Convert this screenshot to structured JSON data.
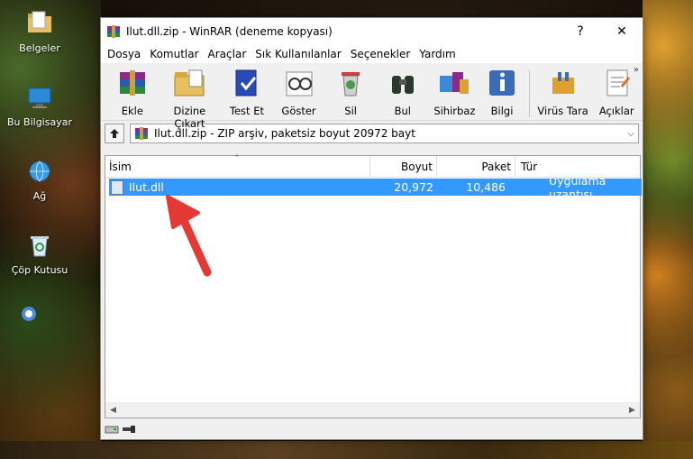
{
  "desktop": {
    "icons": [
      {
        "label": "Belgeler"
      },
      {
        "label": "Bu Bilgisayar"
      },
      {
        "label": "Ağ"
      },
      {
        "label": "Çöp Kutusu"
      }
    ]
  },
  "window": {
    "title": "Ilut.dll.zip - WinRAR (deneme kopyası)",
    "help_label": "?",
    "close_label": "✕"
  },
  "menu": [
    "Dosya",
    "Komutlar",
    "Araçlar",
    "Sık Kullanılanlar",
    "Seçenekler",
    "Yardım"
  ],
  "toolbar": {
    "buttons": [
      {
        "label": "Ekle",
        "icon": "add-archive-icon"
      },
      {
        "label": "Dizine Çıkart",
        "icon": "extract-to-icon"
      },
      {
        "label": "Test Et",
        "icon": "test-icon"
      },
      {
        "label": "Göster",
        "icon": "view-icon"
      },
      {
        "label": "Sil",
        "icon": "delete-icon"
      },
      {
        "label": "Bul",
        "icon": "find-icon"
      },
      {
        "label": "Sihirbaz",
        "icon": "wizard-icon"
      },
      {
        "label": "Bilgi",
        "icon": "info-icon"
      },
      {
        "label": "Virüs Tara",
        "icon": "virus-scan-icon"
      },
      {
        "label": "Açıklar",
        "icon": "comment-icon"
      }
    ],
    "more": "»"
  },
  "address": {
    "path": "Ilut.dll.zip - ZIP arşiv, paketsiz boyut 20972 bayt"
  },
  "columns": {
    "name": "İsim",
    "size": "Boyut",
    "packed": "Paket",
    "type": "Tür"
  },
  "files": [
    {
      "name": "Ilut.dll",
      "size": "20,972",
      "packed": "10,486",
      "type": "Uygulama uzantısı",
      "selected": true
    }
  ],
  "colors": {
    "selection": "#3399ff",
    "arrow": "#e53935"
  }
}
